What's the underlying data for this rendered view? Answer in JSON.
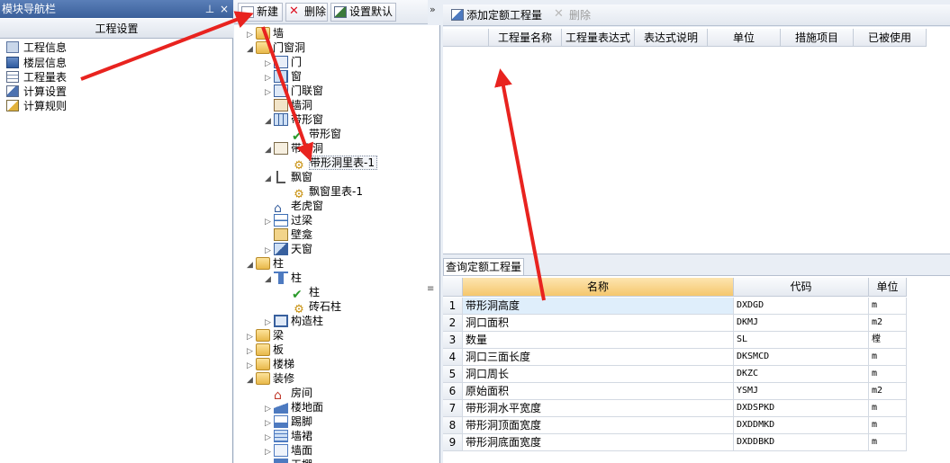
{
  "nav": {
    "title": "模块导航栏",
    "pin": "ㅁ",
    "close": "×",
    "section": "工程设置",
    "items": [
      "工程信息",
      "楼层信息",
      "工程量表",
      "计算设置",
      "计算规则"
    ]
  },
  "toolbar": {
    "new_label": "新建",
    "delete_label": "删除",
    "defaults_label": "设置默认",
    "collapse": "»"
  },
  "tree": {
    "wall": "墙",
    "door_window_opening": "门窗洞",
    "door": "门",
    "window": "窗",
    "door_window_combo": "门联窗",
    "wall_opening": "墙洞",
    "strip_window": "带形窗",
    "strip_window_child": "带形窗",
    "strip_opening": "带形洞",
    "strip_opening_table": "带形洞里表-1",
    "bay_window": "飘窗",
    "bay_window_table": "飘窗里表-1",
    "dormer": "老虎窗",
    "lintel": "过梁",
    "niche": "壁龛",
    "skylight": "天窗",
    "column": "柱",
    "column_group": "柱",
    "column_child": "柱",
    "masonry_column": "砖石柱",
    "structural_column": "构造柱",
    "beam": "梁",
    "slab": "板",
    "stair": "楼梯",
    "finishing": "装修",
    "room": "房间",
    "floor": "楼地面",
    "skirting": "踢脚",
    "dado": "墙裙",
    "wall_face": "墙面",
    "ceiling": "天棚"
  },
  "right_toolbar": {
    "add_label": "添加定额工程量",
    "delete_label": "删除"
  },
  "upper_grid": {
    "headers": [
      "",
      "工程量名称",
      "工程量表达式",
      "表达式说明",
      "单位",
      "措施项目",
      "已被使用"
    ]
  },
  "lower": {
    "tab_label": "查询定额工程量",
    "headers": [
      "名称",
      "代码",
      "单位"
    ],
    "rows": [
      {
        "n": "1",
        "name": "带形洞高度",
        "code": "DXDGD",
        "unit": "m"
      },
      {
        "n": "2",
        "name": "洞口面积",
        "code": "DKMJ",
        "unit": "m2"
      },
      {
        "n": "3",
        "name": "数量",
        "code": "SL",
        "unit": "樘"
      },
      {
        "n": "4",
        "name": "洞口三面长度",
        "code": "DKSMCD",
        "unit": "m"
      },
      {
        "n": "5",
        "name": "洞口周长",
        "code": "DKZC",
        "unit": "m"
      },
      {
        "n": "6",
        "name": "原始面积",
        "code": "YSMJ",
        "unit": "m2"
      },
      {
        "n": "7",
        "name": "带形洞水平宽度",
        "code": "DXDSPKD",
        "unit": "m"
      },
      {
        "n": "8",
        "name": "带形洞顶面宽度",
        "code": "DXDDMKD",
        "unit": "m"
      },
      {
        "n": "9",
        "name": "带形洞底面宽度",
        "code": "DXDDBKD",
        "unit": "m"
      }
    ]
  },
  "colors": {
    "annotation_arrow": "#e8231f",
    "title_bar": "#3a5f9a",
    "header_active": "#f5c76d"
  }
}
